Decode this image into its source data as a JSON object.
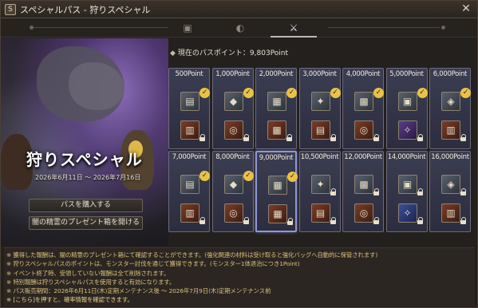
{
  "window": {
    "title_icon": "S",
    "title": "スペシャルパス - 狩りスペシャル",
    "close": "✕"
  },
  "tabs": [
    {
      "icon": "calendar-icon",
      "glyph": "▣"
    },
    {
      "icon": "shield-icon",
      "glyph": "◐"
    },
    {
      "icon": "crossed-swords-icon",
      "glyph": "⚔",
      "active": true
    }
  ],
  "hero": {
    "title": "狩りスペシャル",
    "date_range": "2026年6月11日 ～ 2026年7月16日",
    "buy_button": "パスを購入する",
    "open_box_button": "闇の精霊のプレゼント箱を開ける"
  },
  "points": {
    "label": "現在のパスポイント：9,803Point"
  },
  "tiers": [
    {
      "label": "500Point",
      "claimed": true,
      "reward": "orange"
    },
    {
      "label": "1,000Point",
      "claimed": true,
      "reward": "orange"
    },
    {
      "label": "2,000Point",
      "claimed": true,
      "reward": "orange"
    },
    {
      "label": "3,000Point",
      "claimed": true,
      "reward": "orange"
    },
    {
      "label": "4,000Point",
      "claimed": true,
      "reward": "orange"
    },
    {
      "label": "5,000Point",
      "claimed": true,
      "reward": "purple"
    },
    {
      "label": "6,000Point",
      "claimed": true,
      "reward": "orange"
    },
    {
      "label": "7,000Point",
      "claimed": true,
      "reward": "orange"
    },
    {
      "label": "8,000Point",
      "claimed": true,
      "reward": "orange"
    },
    {
      "label": "9,000Point",
      "claimed": true,
      "reward": "orange",
      "current": true
    },
    {
      "label": "10,500Point",
      "claimed": false,
      "reward": "orange"
    },
    {
      "label": "12,000Point",
      "claimed": false,
      "reward": "orange"
    },
    {
      "label": "14,000Point",
      "claimed": false,
      "reward": "blue"
    },
    {
      "label": "16,000Point",
      "claimed": false,
      "reward": "orange"
    }
  ],
  "notes": [
    "※ 獲得した報酬は、闇の精霊のプレゼント箱にて確認することができます。(強化関連の材料は受け取ると強化バッグへ自動的に保管されます)",
    "※ 狩りスペシャルパスのポイントは、モンスター討伐を通じて獲得できます。(モンスター1体退治につき1Point)",
    "※ イベント終了時、受領していない報酬は全て削除されます。",
    "※ 特別報酬は狩りスペシャルパスを使用すると有効になります。",
    "※ パス販売期間：2026年6月11日(木)定期メンテナンス後 ～ 2026年7月9日(木)定期メンテナンス前",
    "※ [こちら]を押すと、確率情報を確認できます。"
  ],
  "colors": {
    "accent": "#e8c347",
    "note_text": "#d8c07a",
    "card_border_current": "#8f97d8"
  }
}
